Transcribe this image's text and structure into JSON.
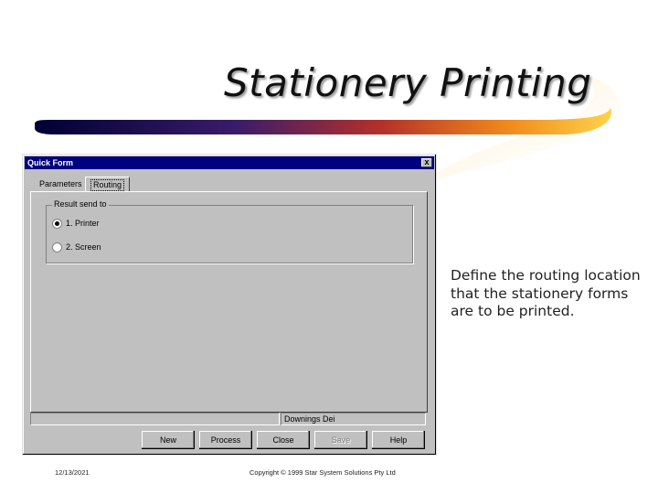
{
  "slide": {
    "title": "Stationery Printing",
    "description": "Define the routing location that the stationery forms are to be printed.",
    "footer_date": "12/13/2021",
    "footer_copyright": "Copyright © 1999 Star System Solutions Pty Ltd"
  },
  "window": {
    "title": "Quick Form",
    "close_label": "x",
    "tabs": [
      {
        "label": "Parameters"
      },
      {
        "label": "Routing",
        "active": true
      }
    ],
    "group_label": "Result send to",
    "radio_options": [
      {
        "label": "1. Printer",
        "checked": true
      },
      {
        "label": "2. Screen",
        "checked": false
      }
    ],
    "status_left": "",
    "status_right": "Downings Dei",
    "buttons": [
      {
        "label": "New",
        "enabled": true
      },
      {
        "label": "Process",
        "enabled": true
      },
      {
        "label": "Close",
        "enabled": true
      },
      {
        "label": "Save",
        "enabled": false
      },
      {
        "label": "Help",
        "enabled": true
      }
    ]
  }
}
